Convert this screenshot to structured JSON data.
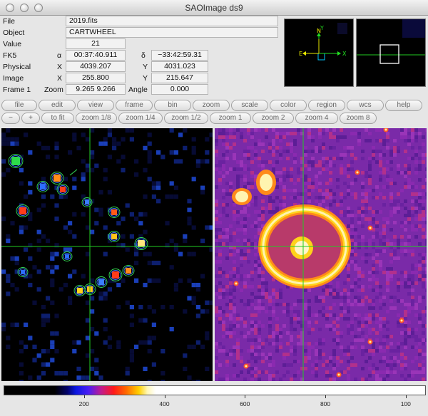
{
  "window": {
    "title": "SAOImage ds9"
  },
  "info": {
    "file_label": "File",
    "file_value": "2019.fits",
    "object_label": "Object",
    "object_value": "CARTWHEEL",
    "value_label": "Value",
    "value_value": "21",
    "fk5_label": "FK5",
    "alpha_symbol": "α",
    "alpha_value": "00:37:40.911",
    "delta_symbol": "δ",
    "delta_value": "−33:42:59.31",
    "physical_label": "Physical",
    "physical_x_label": "X",
    "physical_x_value": "4039.207",
    "physical_y_label": "Y",
    "physical_y_value": "4031.023",
    "image_label": "Image",
    "image_x_label": "X",
    "image_x_value": "255.800",
    "image_y_label": "Y",
    "image_y_value": "215.647",
    "frame_label": "Frame 1",
    "zoom_label": "Zoom",
    "zoom_value": "9.265  9.266",
    "angle_label": "Angle",
    "angle_value": "0.000"
  },
  "panner": {
    "e_label": "E",
    "n_label": "N",
    "x_label": "X",
    "y_label": "Y"
  },
  "buttonbar": {
    "main": [
      "file",
      "edit",
      "view",
      "frame",
      "bin",
      "zoom",
      "scale",
      "color",
      "region",
      "wcs",
      "help"
    ],
    "zoom": [
      "−",
      "+",
      "to fit",
      "zoom 1/8",
      "zoom 1/4",
      "zoom 1/2",
      "zoom 1",
      "zoom 2",
      "zoom 4",
      "zoom 8"
    ]
  },
  "colorbar": {
    "ticks": [
      {
        "value": 200,
        "label": "200"
      },
      {
        "value": 400,
        "label": "400"
      },
      {
        "value": 600,
        "label": "600"
      },
      {
        "value": 800,
        "label": "800"
      },
      {
        "value": 1000,
        "label": "100"
      }
    ],
    "max": 1050
  },
  "colors": {
    "crosshair": "#22cc22",
    "frame_bg": "#000000",
    "right_bg": "#7a2aa8",
    "ring": "#ffd21a"
  }
}
